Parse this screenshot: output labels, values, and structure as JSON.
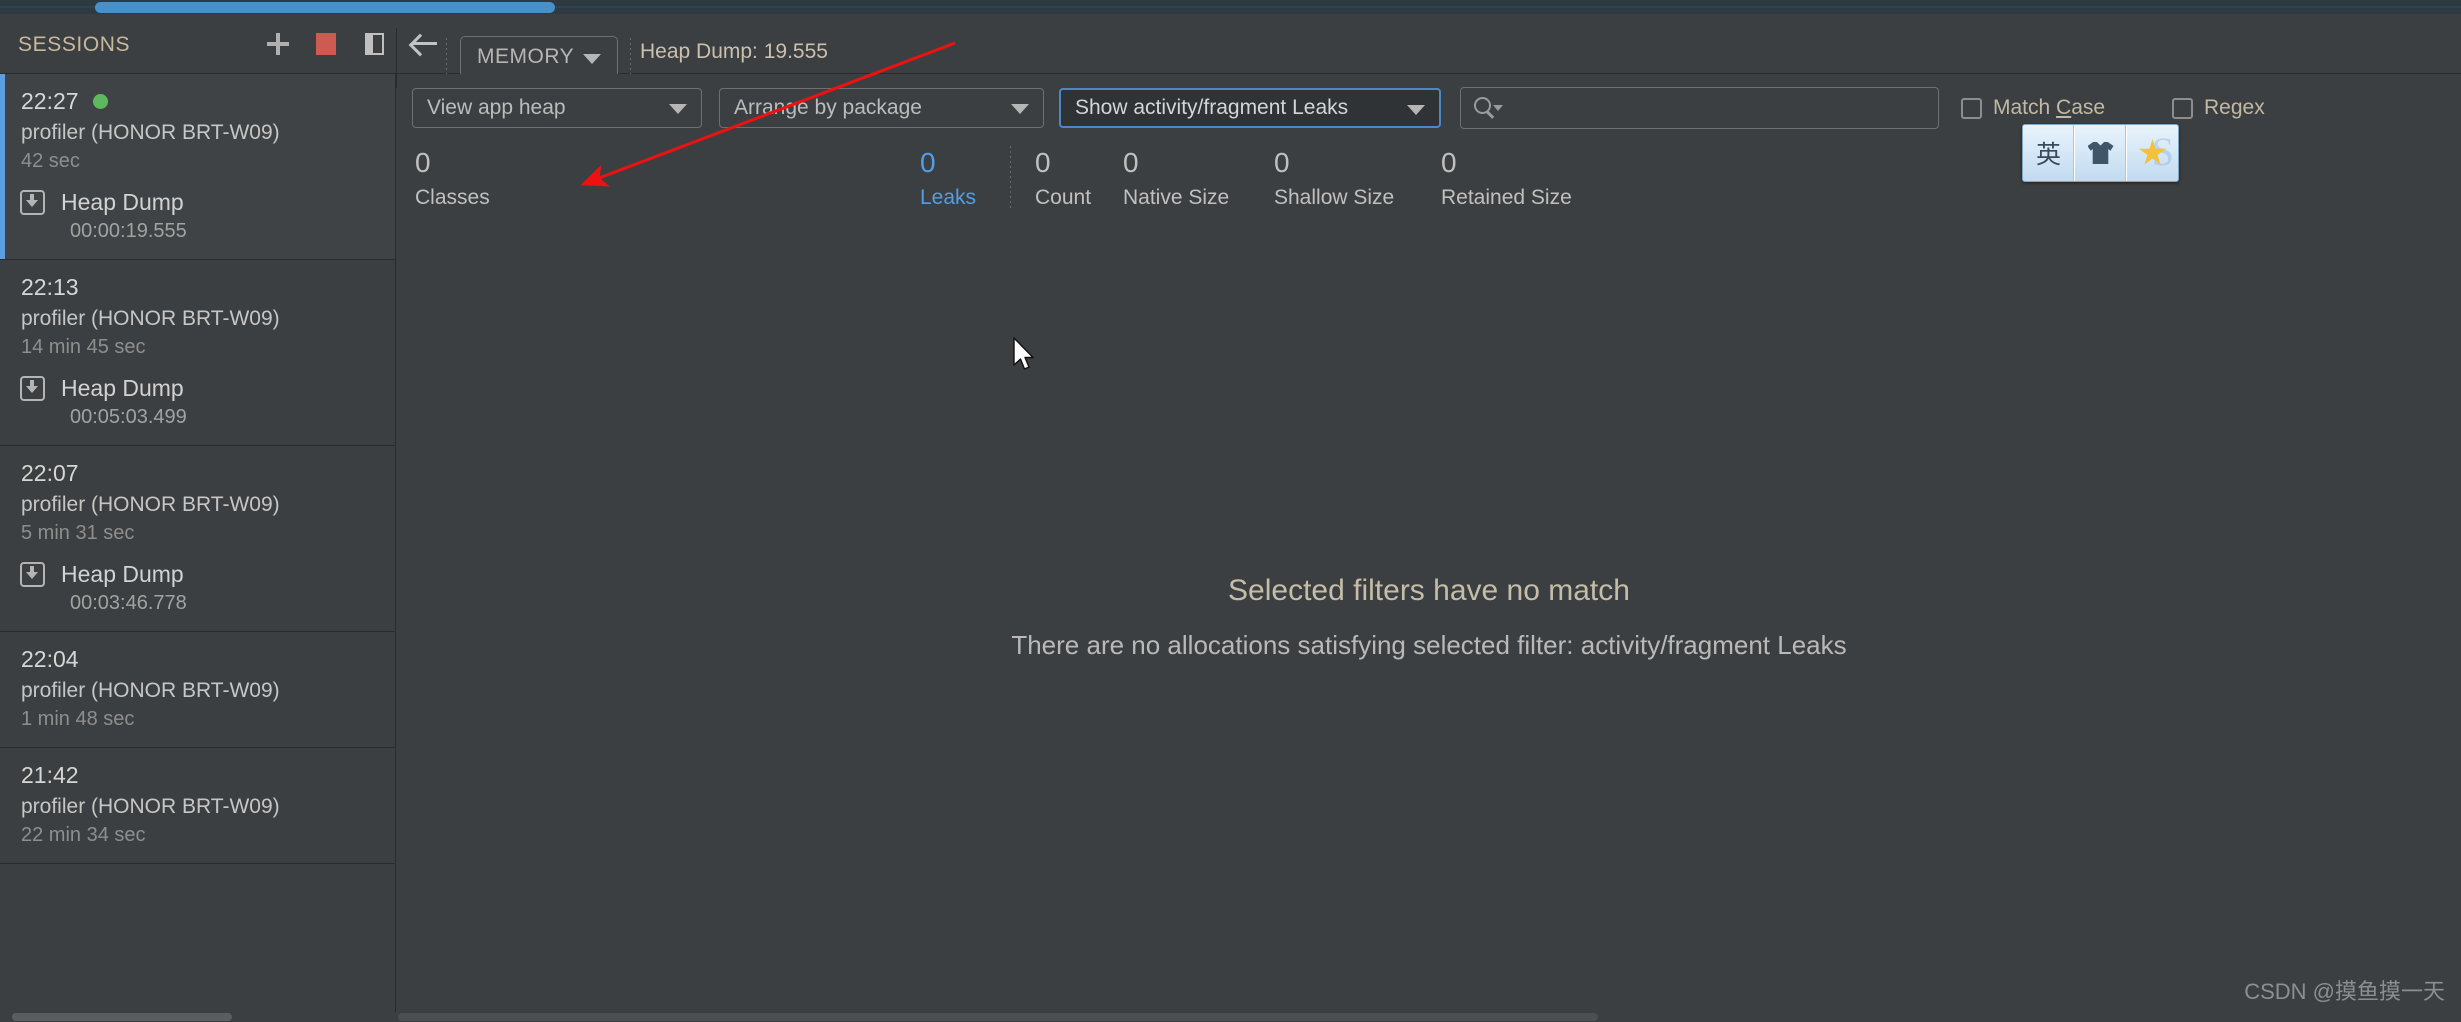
{
  "window": {
    "progress_active": true
  },
  "header": {
    "sessions_title": "SESSIONS",
    "icons": {
      "add": "plus-icon",
      "stop": "stop-record-icon",
      "panel": "toggle-panel-icon",
      "back": "back-arrow-icon"
    },
    "stage_selector": {
      "label": "MEMORY"
    },
    "capture_title": "Heap Dump: 19.555"
  },
  "sessions": [
    {
      "time": "22:27",
      "live": true,
      "device": "profiler (HONOR BRT-W09)",
      "duration": "42 sec",
      "selected": true,
      "capture": {
        "name": "Heap Dump",
        "timestamp": "00:00:19.555"
      }
    },
    {
      "time": "22:13",
      "live": false,
      "device": "profiler (HONOR BRT-W09)",
      "duration": "14 min 45 sec",
      "selected": false,
      "capture": {
        "name": "Heap Dump",
        "timestamp": "00:05:03.499"
      }
    },
    {
      "time": "22:07",
      "live": false,
      "device": "profiler (HONOR BRT-W09)",
      "duration": "5 min 31 sec",
      "selected": false,
      "capture": {
        "name": "Heap Dump",
        "timestamp": "00:03:46.778"
      }
    },
    {
      "time": "22:04",
      "live": false,
      "device": "profiler (HONOR BRT-W09)",
      "duration": "1 min 48 sec",
      "selected": false,
      "capture": null
    },
    {
      "time": "21:42",
      "live": false,
      "device": "profiler (HONOR BRT-W09)",
      "duration": "22 min 34 sec",
      "selected": false,
      "capture": null
    }
  ],
  "filters": {
    "heap_selector": "View app heap",
    "arrange_selector": "Arrange by package",
    "leak_selector": "Show activity/fragment Leaks",
    "search": {
      "value": "",
      "placeholder": ""
    },
    "match_case": {
      "label_pre": "Match ",
      "label_key": "C",
      "label_post": "ase",
      "checked": false
    },
    "regex": {
      "label_pre": "Re",
      "label_key": "g",
      "label_post": "ex",
      "checked": false
    }
  },
  "stats": [
    {
      "value": "0",
      "caption": "Classes",
      "highlight": false
    },
    {
      "value": "0",
      "caption": "Leaks",
      "highlight": true
    },
    {
      "value": "0",
      "caption": "Count",
      "highlight": false
    },
    {
      "value": "0",
      "caption": "Native Size",
      "highlight": false
    },
    {
      "value": "0",
      "caption": "Shallow Size",
      "highlight": false
    },
    {
      "value": "0",
      "caption": "Retained Size",
      "highlight": false
    }
  ],
  "empty_state": {
    "title": "Selected filters have no match",
    "subtitle": "There are no allocations satisfying selected filter: activity/fragment Leaks"
  },
  "ime_widget": {
    "mode": "英",
    "skin_icon": "shirt-icon",
    "star_icon": "star-icon"
  },
  "annotation": {
    "color": "#ee1111"
  },
  "colors": {
    "accent_blue": "#4f9fe8",
    "selection_blue": "#5c9ee0",
    "stop_red": "#cf5a51",
    "live_green": "#5eb85e",
    "panel_bg": "#3c3f41"
  },
  "watermark": "CSDN @摸鱼摸一天"
}
